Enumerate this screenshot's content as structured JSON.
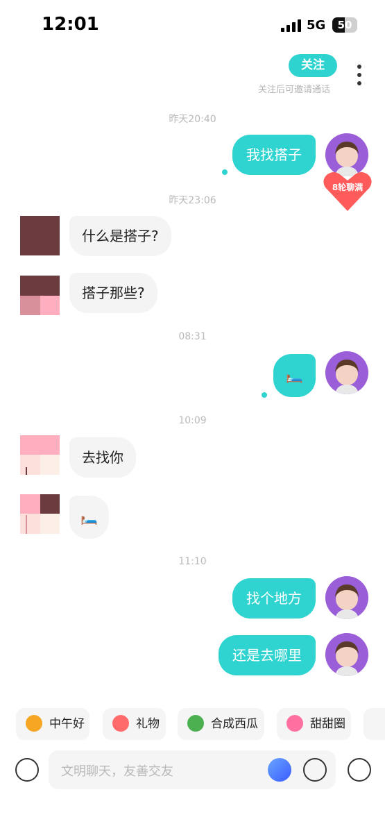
{
  "status_bar": {
    "time": "12:01",
    "network": "5G",
    "battery": "50",
    "battery_level": 0.5
  },
  "header": {
    "follow_label": "关注",
    "follow_hint": "关注后可邀请通话"
  },
  "messages": {
    "ts1": "昨天20:40",
    "m1": "我找搭子",
    "badge": "8轮聊满",
    "ts2": "昨天23:06",
    "m2": "什么是搭子?",
    "m3": "搭子那些?",
    "ts3": "08:31",
    "m4": "🛏️",
    "ts4": "10:09",
    "m5": "去找你",
    "m6": "🛏️",
    "ts5": "11:10",
    "m7": "找个地方",
    "m8": "还是去哪里"
  },
  "quick_actions": [
    {
      "label": "中午好",
      "icon": "sun-sunglasses-icon",
      "color": "#f6a623"
    },
    {
      "label": "礼物",
      "icon": "gift-icon",
      "color": "#ff6b6b"
    },
    {
      "label": "合成西瓜",
      "icon": "watermelon-icon",
      "color": "#4caf50"
    },
    {
      "label": "甜甜圈",
      "icon": "donut-icon",
      "color": "#ff6fa0"
    }
  ],
  "input": {
    "placeholder": "文明聊天，友善交友"
  }
}
